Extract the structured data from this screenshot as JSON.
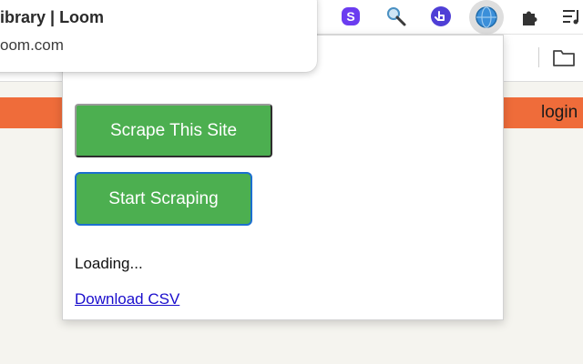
{
  "browser": {
    "tab_hover_card": {
      "title": "ibrary | Loom",
      "url": "oom.com"
    },
    "extensions": [
      {
        "name": "skype-extension-icon",
        "color": "#6b3cf0"
      },
      {
        "name": "search-magnifier-extension-icon",
        "color": "#4a90c2"
      },
      {
        "name": "hand-pointer-extension-icon",
        "color": "#4f3fd6"
      },
      {
        "name": "globe-scraper-extension-icon",
        "color": "#3b8fd9"
      },
      {
        "name": "puzzle-extensions-icon",
        "color": "#333333"
      },
      {
        "name": "reading-list-icon",
        "color": "#333333"
      }
    ]
  },
  "page": {
    "login_label": "login",
    "accent_color": "#ef6c3a"
  },
  "popup": {
    "scrape_site_label": "Scrape This Site",
    "start_scraping_label": "Start Scraping",
    "status": "Loading...",
    "download_label": "Download CSV",
    "button_color": "#4caf50"
  }
}
